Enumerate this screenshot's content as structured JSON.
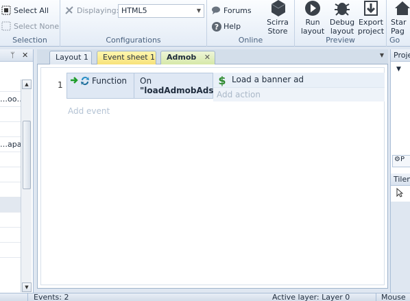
{
  "ribbon": {
    "selection": {
      "select_all": "Select All",
      "select_none": "Select None",
      "label": "Selection"
    },
    "configurations": {
      "displaying_label": "Displaying:",
      "displaying_value": "HTML5",
      "label": "Configurations"
    },
    "online": {
      "forums": "Forums",
      "help": "Help",
      "store_line1": "Scirra",
      "store_line2": "Store",
      "label": "Online"
    },
    "preview": {
      "run_line1": "Run",
      "run_line2": "layout",
      "debug_line1": "Debug",
      "debug_line2": "layout",
      "export_line1": "Export",
      "export_line2": "project",
      "label": "Preview"
    },
    "goto": {
      "line1": "Star",
      "line2": "Pag",
      "label": "Go"
    }
  },
  "left_panel": {
    "rows": [
      "",
      "…oo…",
      "",
      "",
      "…apa…",
      "",
      "",
      "",
      "",
      "",
      "",
      "",
      ""
    ],
    "selected_index": 8
  },
  "tabs": [
    {
      "label": "Layout 1"
    },
    {
      "label": "Event sheet 1"
    },
    {
      "label": "Admob",
      "close": "✕"
    }
  ],
  "event": {
    "number": "1",
    "object": "Function",
    "condition_line1": "On",
    "condition_line2": "\"loadAdmobAds\"",
    "action": "Load a banner ad",
    "add_action": "Add action",
    "add_event": "Add event"
  },
  "right_panel": {
    "projects_head": "Proje",
    "tilemap_head": "Tilem",
    "tab_label": "P"
  },
  "status": {
    "events": "Events: 2",
    "active_layer": "Active layer: Layer 0",
    "mouse": "Mouse"
  },
  "colors": {
    "ribbon_bg": "#e4ecf6",
    "event_sheet_tab": "#f7e27a",
    "admob_tab": "#d6e8a8",
    "condition_bg": "#dfe8f4",
    "action_bg": "#e9f0f8"
  },
  "icons": [
    "select-all-icon",
    "select-none-icon",
    "displaying-icon",
    "forums-icon",
    "help-icon",
    "store-icon",
    "run-icon",
    "debug-icon",
    "export-icon",
    "goto-icon",
    "pin-icon",
    "close-icon",
    "function-icon",
    "dollar-icon",
    "arrow-icon",
    "cursor-icon"
  ]
}
